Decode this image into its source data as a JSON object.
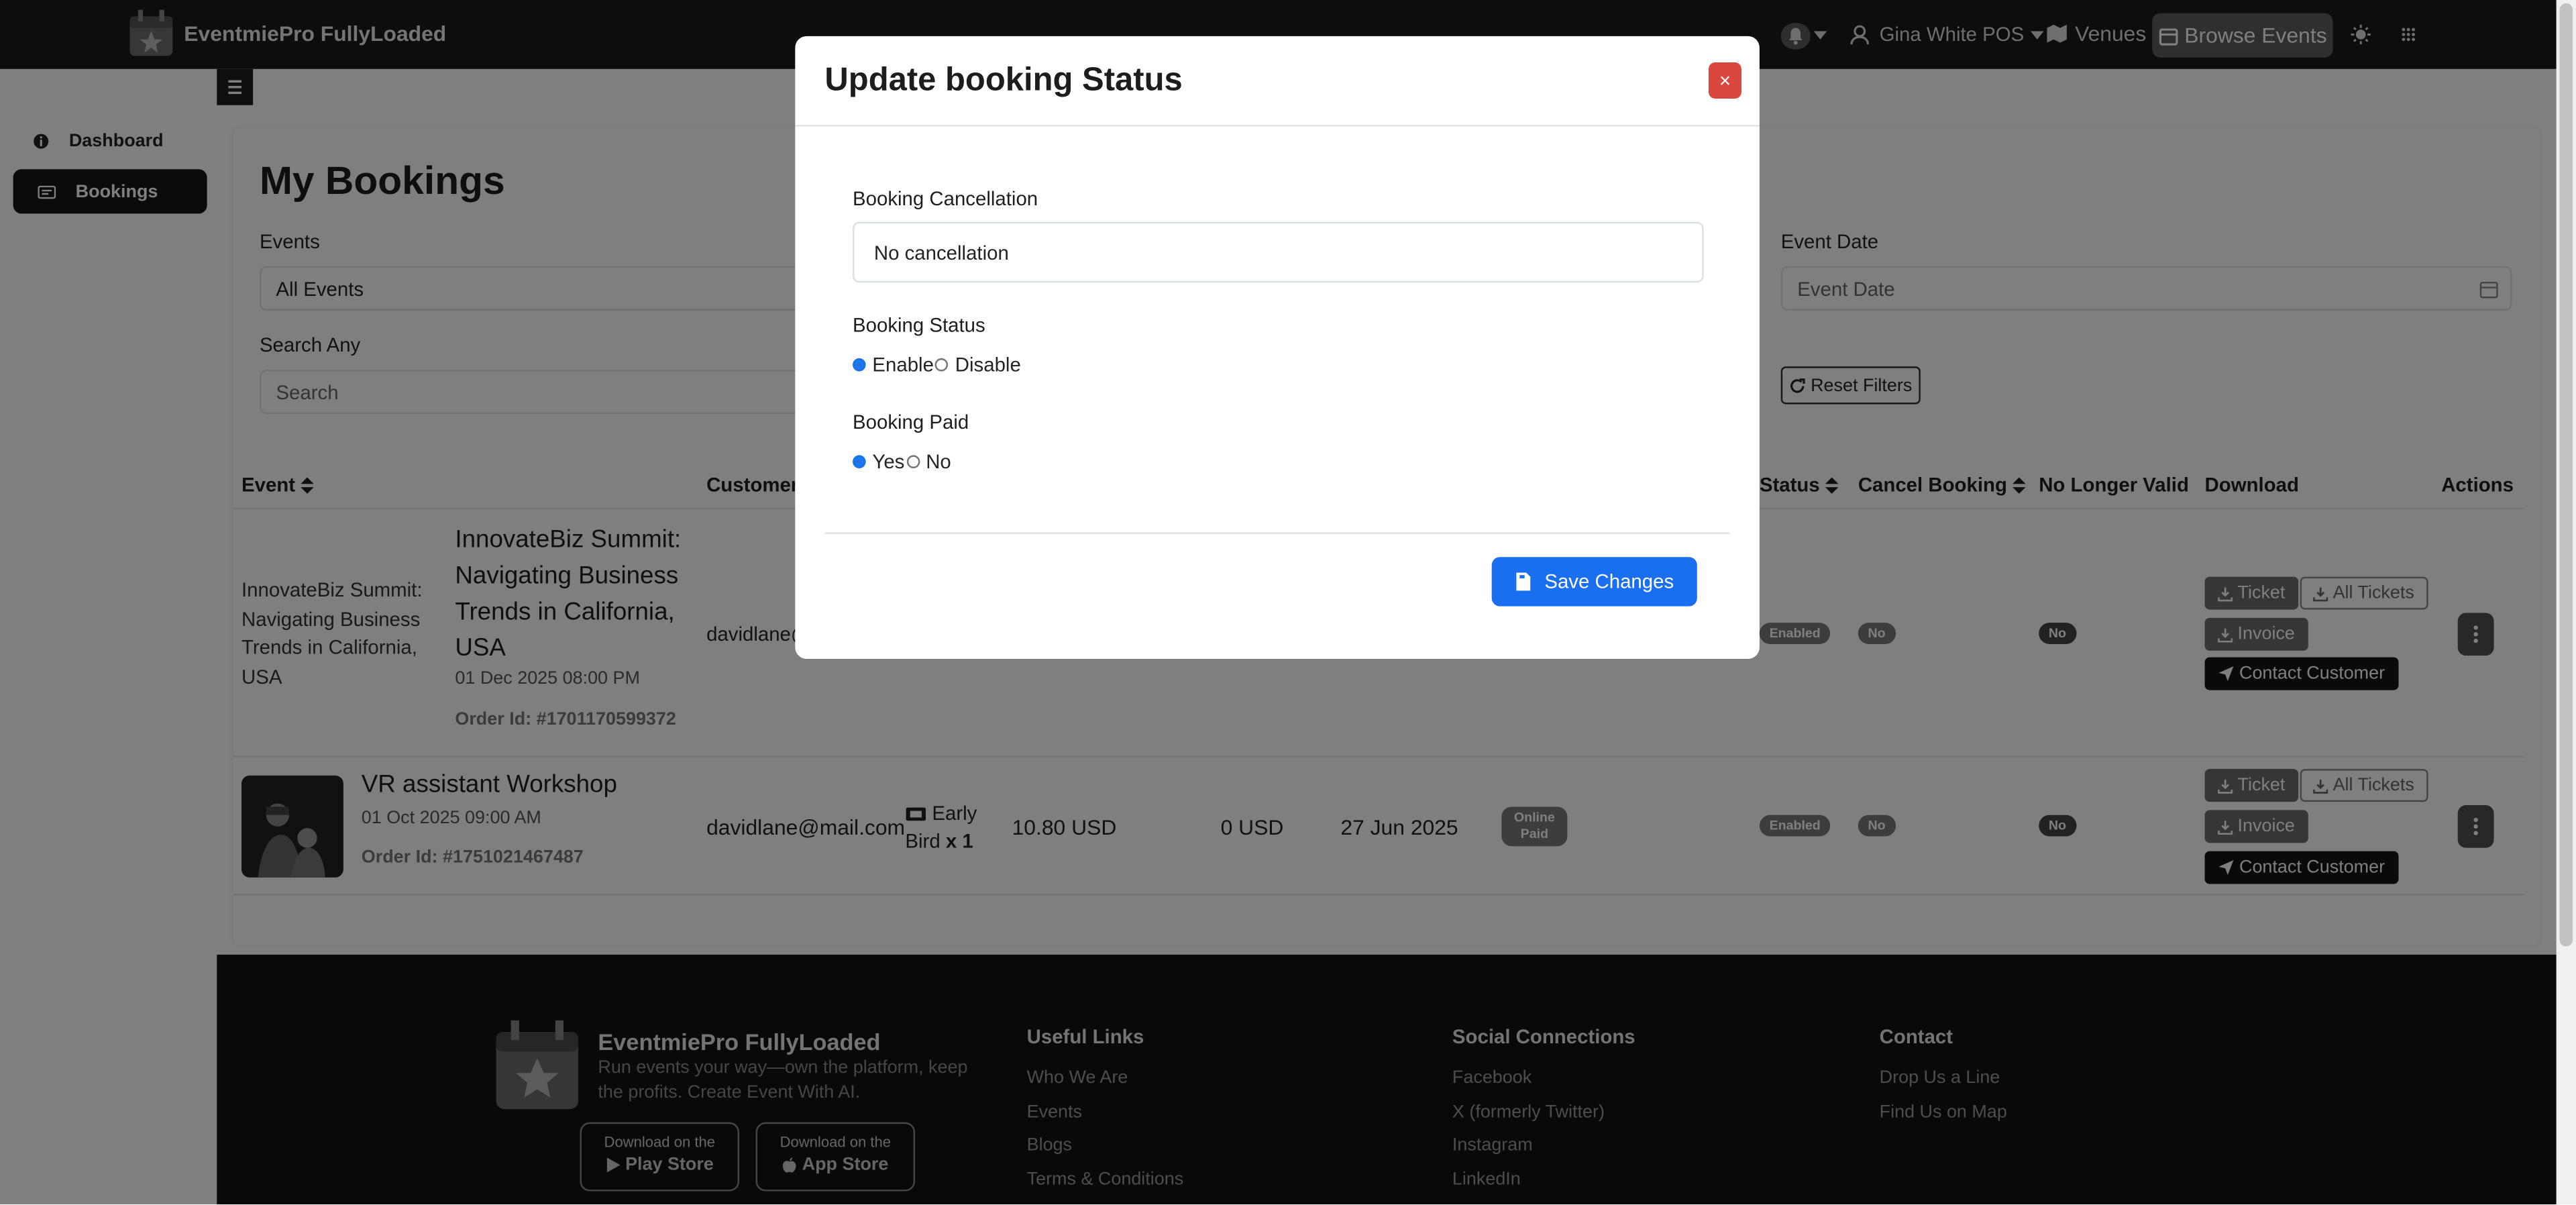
{
  "brand": {
    "name": "EventmiePro FullyLoaded"
  },
  "nav": {
    "user": "Gina White POS",
    "venues": "Venues",
    "browse_events": "Browse Events"
  },
  "sidebar": {
    "items": [
      {
        "label": "Dashboard",
        "icon": "info-icon"
      },
      {
        "label": "Bookings",
        "icon": "ticket-icon"
      }
    ]
  },
  "page": {
    "title": "My Bookings",
    "filters": {
      "events_label": "Events",
      "events_value": "All Events",
      "date_label": "Event Date",
      "date_placeholder": "Event Date",
      "search_label": "Search Any",
      "search_placeholder": "Search",
      "reset": "Reset Filters"
    },
    "table": {
      "headers": [
        "Event",
        "Customer",
        "Status",
        "Cancel Booking",
        "No Longer Valid",
        "Download",
        "Actions"
      ],
      "rows": [
        {
          "image_alt": "InnovateBiz Summit: Navigating Business Trends in California, USA",
          "title": "InnovateBiz Summit: Navigating Business Trends in California, USA",
          "date": "01 Dec 2025 08:00 PM",
          "order": "Order Id: #1701170599372",
          "customer": "davidlane@",
          "status": "Enabled",
          "cancel": "No",
          "valid": "No"
        },
        {
          "title": "VR assistant Workshop",
          "date": "01 Oct 2025 09:00 AM",
          "order": "Order Id: #1751021467487",
          "customer": "davidlane@mail.com",
          "ticket": "Early Bird",
          "qty": "x 1",
          "price": "10.80 USD",
          "tax": "0 USD",
          "booked_on": "27 Jun 2025",
          "payment": "Online Paid",
          "status": "Enabled",
          "cancel": "No",
          "valid": "No"
        }
      ],
      "buttons": {
        "ticket": "Ticket",
        "all_tickets": "All Tickets",
        "invoice": "Invoice",
        "contact": "Contact Customer"
      }
    }
  },
  "footer": {
    "brand": "EventmiePro FullyLoaded",
    "tagline": "Run events your way—own the platform, keep the profits. Create Event With AI.",
    "play_small": "Download on the",
    "play_big": "Play Store",
    "app_small": "Download on the",
    "app_big": "App Store",
    "useful_title": "Useful Links",
    "useful": [
      "Who We Are",
      "Events",
      "Blogs",
      "Terms & Conditions"
    ],
    "social_title": "Social Connections",
    "social": [
      "Facebook",
      "X (formerly Twitter)",
      "Instagram",
      "LinkedIn"
    ],
    "contact_title": "Contact",
    "contact": [
      "Drop Us a Line",
      "Find Us on Map"
    ]
  },
  "modal": {
    "title": "Update booking Status",
    "close": "×",
    "cancellation_label": "Booking Cancellation",
    "cancellation_value": "No cancellation",
    "status_label": "Booking Status",
    "status_options": [
      "Enable",
      "Disable"
    ],
    "status_selected": "Enable",
    "paid_label": "Booking Paid",
    "paid_options": [
      "Yes",
      "No"
    ],
    "paid_selected": "Yes",
    "save": "Save Changes"
  }
}
